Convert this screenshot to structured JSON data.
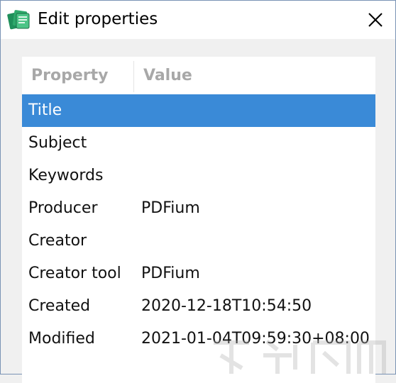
{
  "window": {
    "title": "Edit properties"
  },
  "icons": {
    "app": "app-icon",
    "close": "close-icon"
  },
  "table": {
    "headers": {
      "property": "Property",
      "value": "Value"
    },
    "rows": [
      {
        "property": "Title",
        "value": "",
        "selected": true
      },
      {
        "property": "Subject",
        "value": ""
      },
      {
        "property": "Keywords",
        "value": ""
      },
      {
        "property": "Producer",
        "value": "PDFium"
      },
      {
        "property": "Creator",
        "value": ""
      },
      {
        "property": "Creator tool",
        "value": "PDFium"
      },
      {
        "property": "Created",
        "value": "2020-12-18T10:54:50"
      },
      {
        "property": "Modified",
        "value": "2021-01-04T09:59:30+08:00"
      }
    ]
  },
  "colors": {
    "selection": "#3a8ad7",
    "header_text": "#a8a8a8"
  }
}
